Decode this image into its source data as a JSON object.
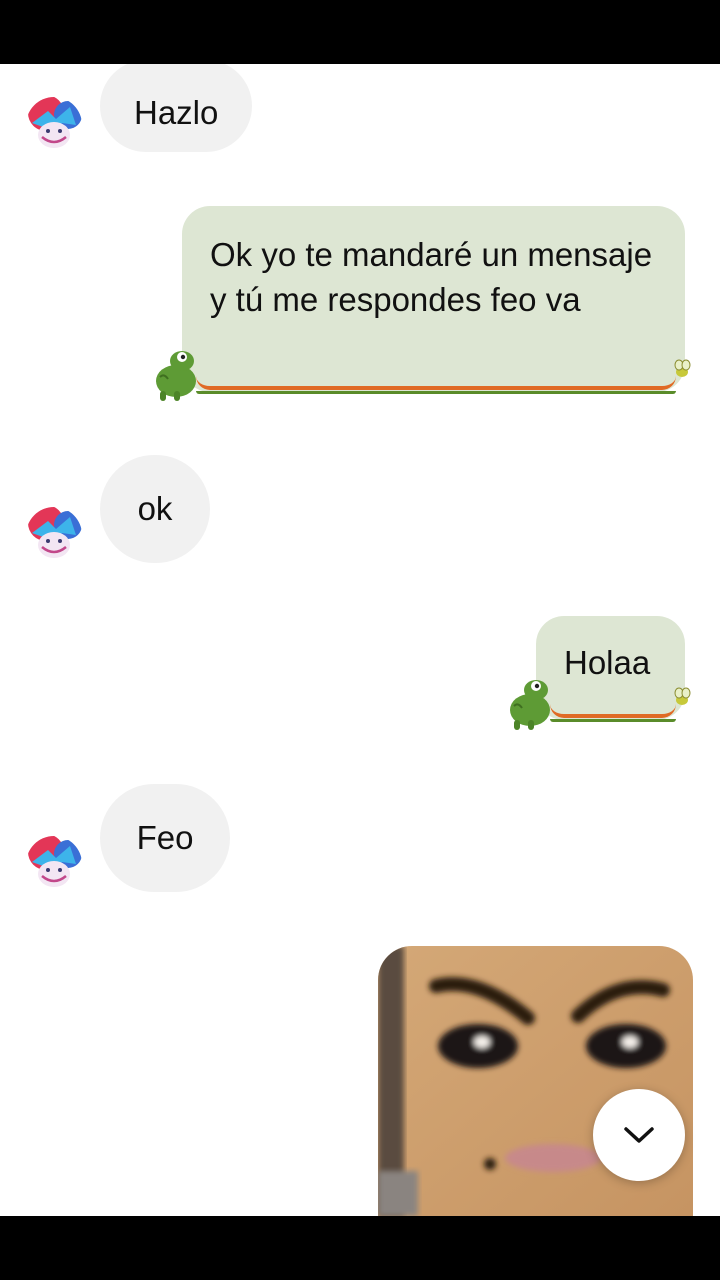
{
  "conversation": {
    "messages": [
      {
        "sender": "them",
        "text": "Hazlo"
      },
      {
        "sender": "me",
        "text": "Ok yo te mandaré un mensaje y tú me respondes feo va"
      },
      {
        "sender": "them",
        "text": "ok"
      },
      {
        "sender": "me",
        "text": "Holaa"
      },
      {
        "sender": "them",
        "text": "Feo"
      },
      {
        "sender": "me",
        "type": "photo"
      }
    ]
  },
  "icons": {
    "avatar": "cartoon-avatar-icon",
    "frog": "frog-sticker-icon",
    "fly": "fly-icon",
    "scroll": "chevron-down-icon"
  },
  "colors": {
    "incoming_bubble": "#f1f1f1",
    "outgoing_bubble": "#dde6d3",
    "tongue": "#e06a25",
    "frog": "#5e9b35"
  }
}
